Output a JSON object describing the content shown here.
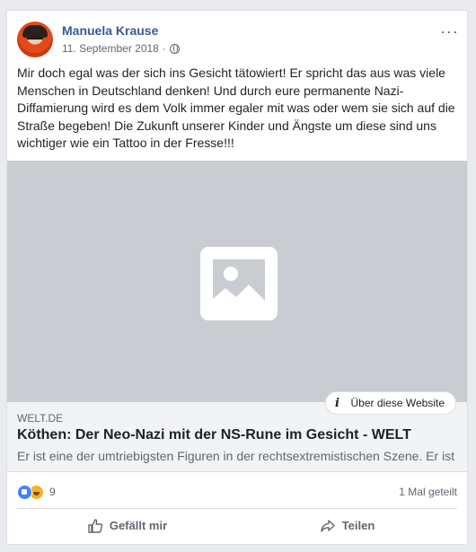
{
  "post": {
    "author": "Manuela Krause",
    "date": "11. September 2018",
    "separator": "·",
    "more_icon": "···",
    "text": "Mir doch egal was der sich ins Gesicht tätowiert! Er spricht das aus was viele Menschen in Deutschland denken! Und durch eure permanente Nazi-Diffamierung wird es dem Volk immer egaler mit was oder wem sie sich auf die Straße begeben! Die Zukunft unserer Kinder und Ängste um diese sind uns wichtiger wie ein Tattoo in der Fresse!!!"
  },
  "link_preview": {
    "about_label": "Über diese Website",
    "domain": "WELT.DE",
    "title": "Köthen: Der Neo-Nazi mit der NS-Rune im Gesicht - WELT",
    "description": "Er ist eine der umtriebigsten Figuren in der rechtsextremistischen Szene. Er ist"
  },
  "reactions": {
    "count": "9",
    "shares": "1 Mal geteilt"
  },
  "actions": {
    "like_label": "Gefällt mir",
    "share_label": "Teilen"
  },
  "colors": {
    "author": "#365899",
    "placeholder_bg": "#c9ccd1",
    "link_bg": "#f2f3f5"
  }
}
